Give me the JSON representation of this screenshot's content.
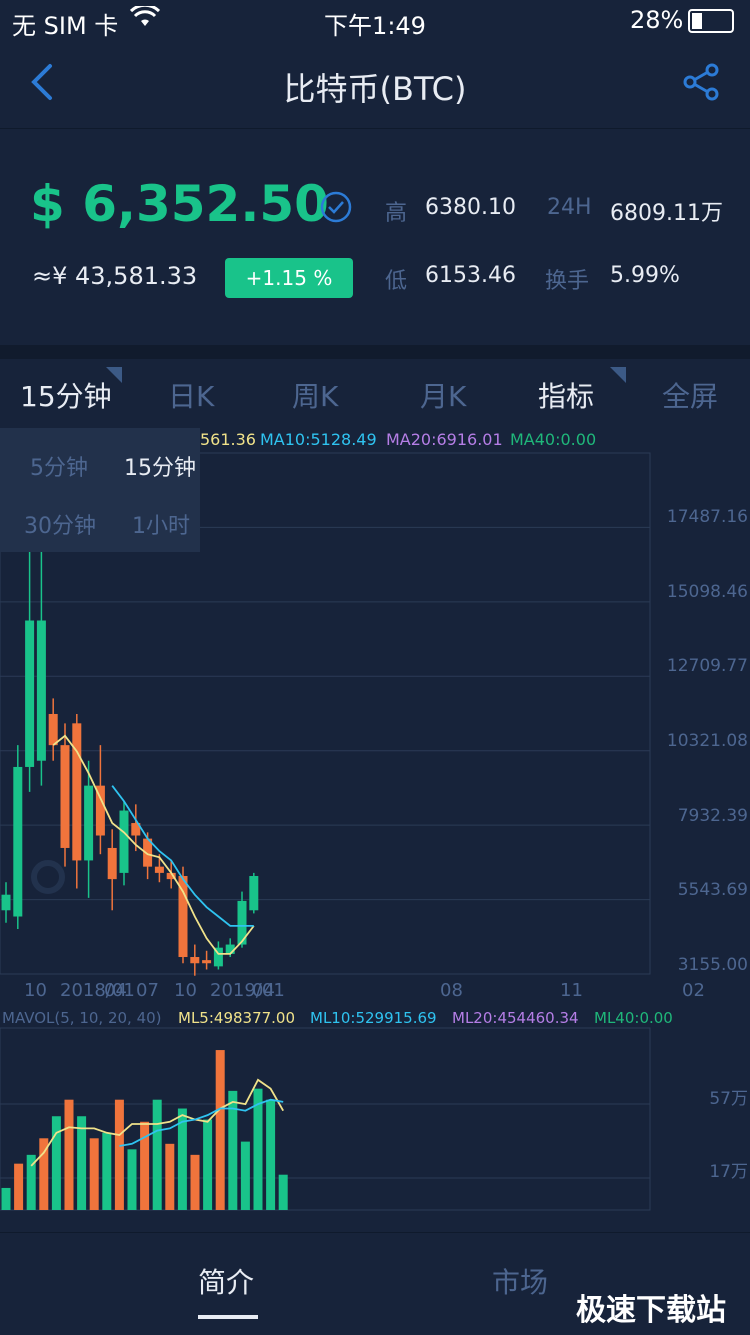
{
  "status": {
    "carrier": "无 SIM 卡",
    "time": "下午1:49",
    "battery": "28%"
  },
  "nav": {
    "title": "比特币(BTC)",
    "back_icon": "back-arrow-icon",
    "share_icon": "share-icon"
  },
  "ticker": {
    "price": "$ 6,352.50",
    "cny": "≈¥ 43,581.33",
    "change": "+1.15 %",
    "high_label": "高",
    "high_value": "6380.10",
    "low_label": "低",
    "low_value": "6153.46",
    "vol_label": "24H",
    "vol_value": "6809.11万",
    "turnover_label": "换手",
    "turnover_value": "5.99%",
    "accent": "#19c38a"
  },
  "tabs": [
    "15分钟",
    "日K",
    "周K",
    "月K",
    "指标",
    "全屏"
  ],
  "interval_menu": [
    "5分钟",
    "15分钟",
    "30分钟",
    "1小时"
  ],
  "chart_data": {
    "type": "candlestick",
    "ma_legend": [
      {
        "text": "561.36",
        "color": "#f0e28a"
      },
      {
        "text": "MA10:5128.49",
        "color": "#2fc3f0"
      },
      {
        "text": "MA20:6916.01",
        "color": "#b57ee6"
      },
      {
        "text": "MA40:0.00",
        "color": "#1fb77a"
      }
    ],
    "y_ticks": [
      "17487.16",
      "15098.46",
      "12709.77",
      "10321.08",
      "7932.39",
      "5543.69",
      "3155.00"
    ],
    "x_ticks": [
      "10",
      "2018/01",
      "04",
      "07",
      "10",
      "2019/01",
      "04",
      "08",
      "11",
      "02"
    ],
    "ylim": [
      3155.0,
      19875.85
    ],
    "candles": [
      {
        "o": 5200,
        "c": 5700,
        "h": 6100,
        "l": 4800
      },
      {
        "o": 5000,
        "c": 9800,
        "h": 10500,
        "l": 4600
      },
      {
        "o": 9800,
        "c": 14500,
        "h": 17500,
        "l": 9000
      },
      {
        "o": 10000,
        "c": 14500,
        "h": 19800,
        "l": 9200
      },
      {
        "o": 11500,
        "c": 10500,
        "h": 12000,
        "l": 10000
      },
      {
        "o": 10500,
        "c": 7200,
        "h": 11200,
        "l": 6600
      },
      {
        "o": 11200,
        "c": 6800,
        "h": 11500,
        "l": 5900
      },
      {
        "o": 6800,
        "c": 9200,
        "h": 10000,
        "l": 5600
      },
      {
        "o": 9200,
        "c": 7600,
        "h": 10500,
        "l": 7000
      },
      {
        "o": 7200,
        "c": 6200,
        "h": 7800,
        "l": 5200
      },
      {
        "o": 6400,
        "c": 8400,
        "h": 8700,
        "l": 6000
      },
      {
        "o": 8000,
        "c": 7600,
        "h": 8600,
        "l": 7100
      },
      {
        "o": 7500,
        "c": 6600,
        "h": 7700,
        "l": 6200
      },
      {
        "o": 6600,
        "c": 6400,
        "h": 7000,
        "l": 6100
      },
      {
        "o": 6400,
        "c": 6200,
        "h": 6800,
        "l": 5900
      },
      {
        "o": 6300,
        "c": 3700,
        "h": 6600,
        "l": 3500
      },
      {
        "o": 3700,
        "c": 3500,
        "h": 4100,
        "l": 3100
      },
      {
        "o": 3600,
        "c": 3500,
        "h": 3900,
        "l": 3300
      },
      {
        "o": 3400,
        "c": 4000,
        "h": 4200,
        "l": 3300
      },
      {
        "o": 3800,
        "c": 4100,
        "h": 4300,
        "l": 3700
      },
      {
        "o": 4100,
        "c": 5500,
        "h": 5800,
        "l": 4000
      },
      {
        "o": 5200,
        "c": 6300,
        "h": 6400,
        "l": 5100
      }
    ],
    "ma5": [
      null,
      null,
      null,
      null,
      10500,
      10800,
      10300,
      9600,
      8800,
      8000,
      7700,
      7300,
      7000,
      6900,
      6400,
      5800,
      5000,
      4300,
      3800,
      3800,
      4200,
      4700
    ],
    "ma10": [
      null,
      null,
      null,
      null,
      null,
      null,
      null,
      null,
      null,
      9200,
      8700,
      8100,
      7500,
      7100,
      6800,
      6200,
      5700,
      5300,
      5000,
      4700,
      4700,
      4700
    ],
    "volume": {
      "legend": [
        {
          "text": "MAVOL(5, 10, 20, 40)",
          "color": "#4d6690"
        },
        {
          "text": "ML5:498377.00",
          "color": "#f0e28a"
        },
        {
          "text": "ML10:529915.69",
          "color": "#2fc3f0"
        },
        {
          "text": "ML20:454460.34",
          "color": "#b57ee6"
        },
        {
          "text": "ML40:0.00",
          "color": "#1fb77a"
        }
      ],
      "ticks": [
        "57万",
        "17万"
      ],
      "bars": [
        20,
        42,
        50,
        65,
        85,
        100,
        85,
        65,
        70,
        100,
        55,
        80,
        100,
        60,
        92,
        50,
        82,
        145,
        108,
        62,
        110,
        100,
        32
      ],
      "ml5": [
        null,
        null,
        40,
        52,
        70,
        75,
        74,
        74,
        70,
        68,
        78,
        78,
        78,
        80,
        86,
        82,
        80,
        92,
        98,
        96,
        118,
        110,
        90
      ],
      "ml10": [
        null,
        null,
        null,
        null,
        null,
        null,
        null,
        null,
        null,
        58,
        60,
        66,
        72,
        74,
        80,
        82,
        86,
        92,
        92,
        90,
        96,
        100,
        98
      ],
      "ylim": [
        0,
        165
      ]
    },
    "up_color": "#19c38a",
    "down_color": "#f0743c"
  },
  "bottom_tabs": [
    "简介",
    "市场"
  ],
  "watermark": "极速下载站"
}
